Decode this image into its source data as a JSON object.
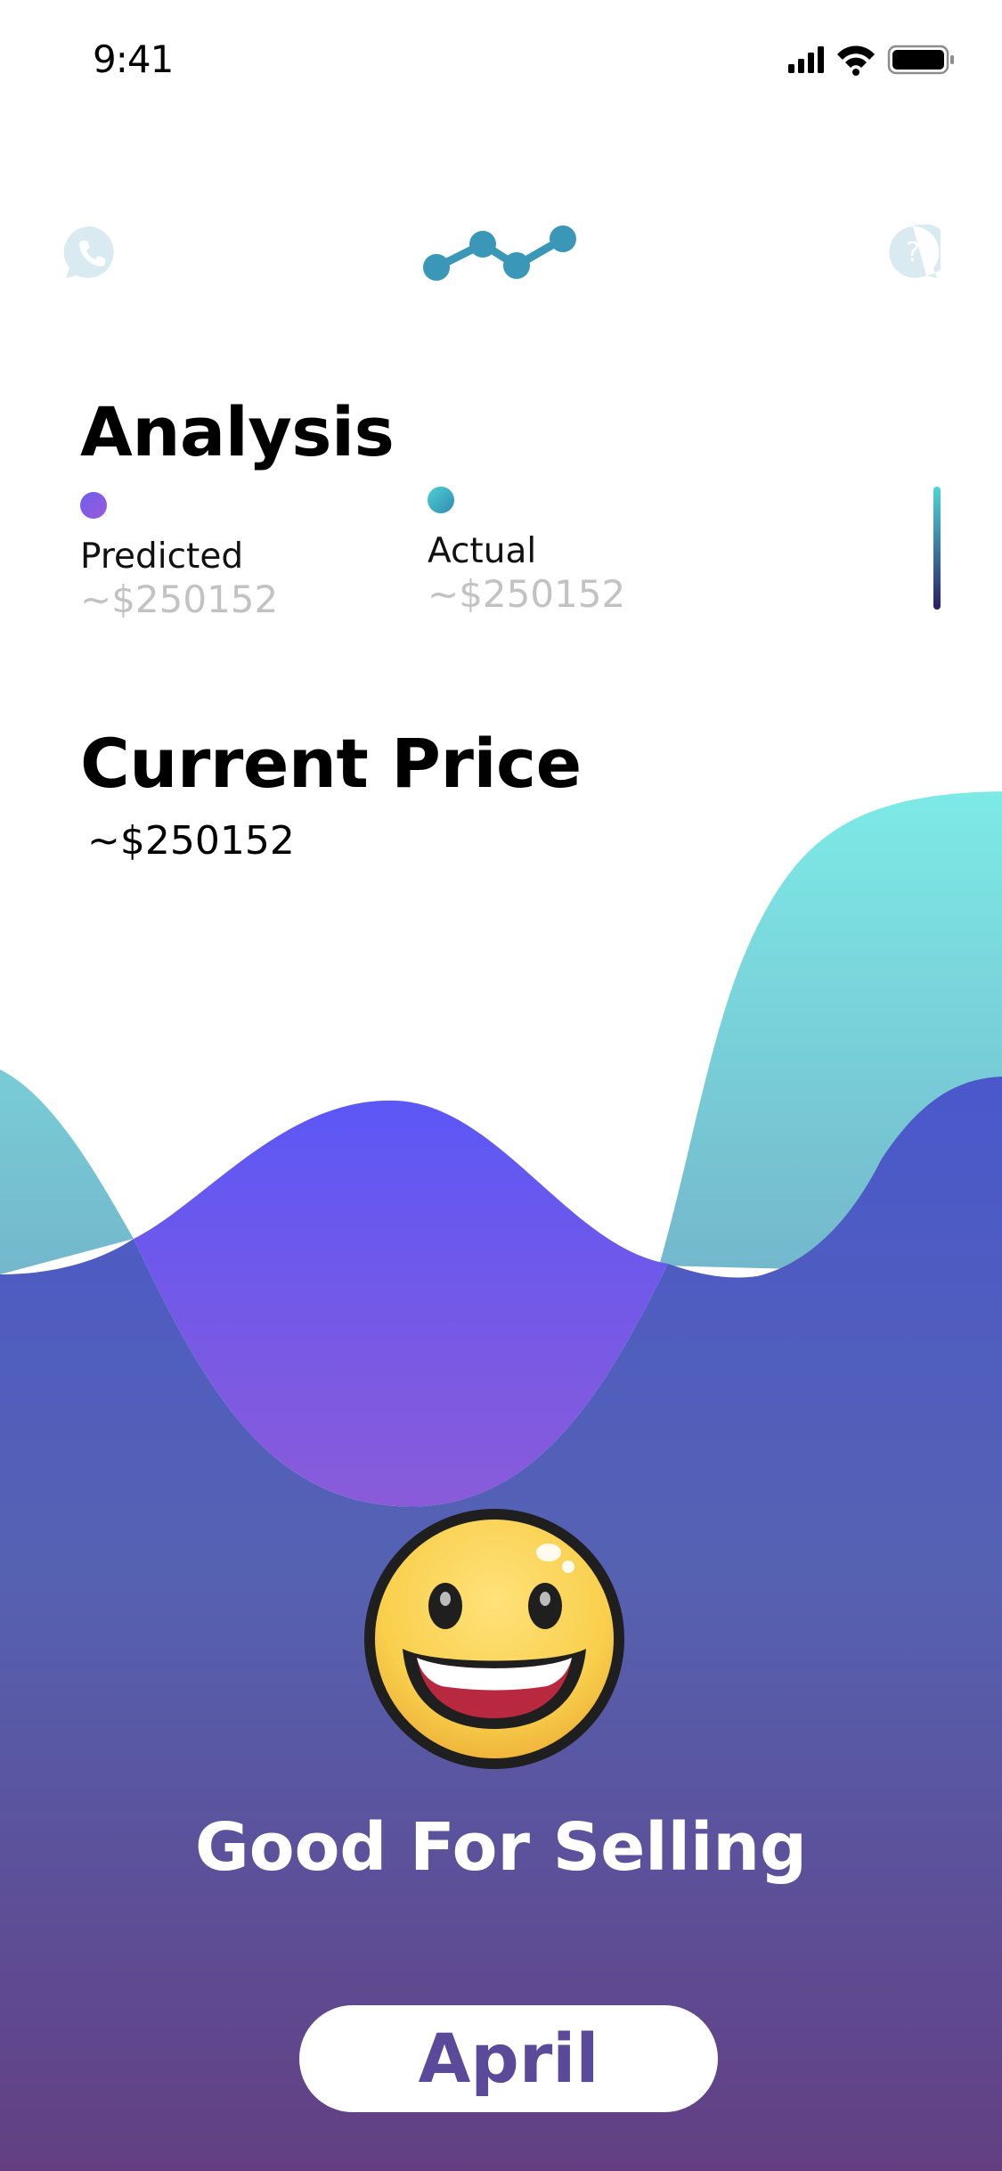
{
  "status_bar": {
    "time": "9:41",
    "icons": [
      "cellular-signal-icon",
      "wifi-icon",
      "battery-icon"
    ]
  },
  "header": {
    "left_icon": "phone-icon",
    "center_icon": "line-chart-icon",
    "right_icon": "help-icon"
  },
  "analysis": {
    "title": "Analysis",
    "predicted": {
      "label": "Predicted",
      "value": "~$250152",
      "color": "#7b5ce6"
    },
    "actual": {
      "label": "Actual",
      "value": "~$250152",
      "color": "#2f9bb8"
    }
  },
  "current_price": {
    "title": "Current Price",
    "value": "~$250152"
  },
  "verdict": {
    "icon": "grinning-face-icon",
    "text": "Good For Selling"
  },
  "month_button": {
    "label": "April"
  },
  "colors": {
    "teal_wave": "#78e9e6",
    "violet_wave": "#5b57f5",
    "indigo_wave": "#4651d3",
    "bottom_purple": "#62407f",
    "accent_blue": "#3a97b8"
  }
}
